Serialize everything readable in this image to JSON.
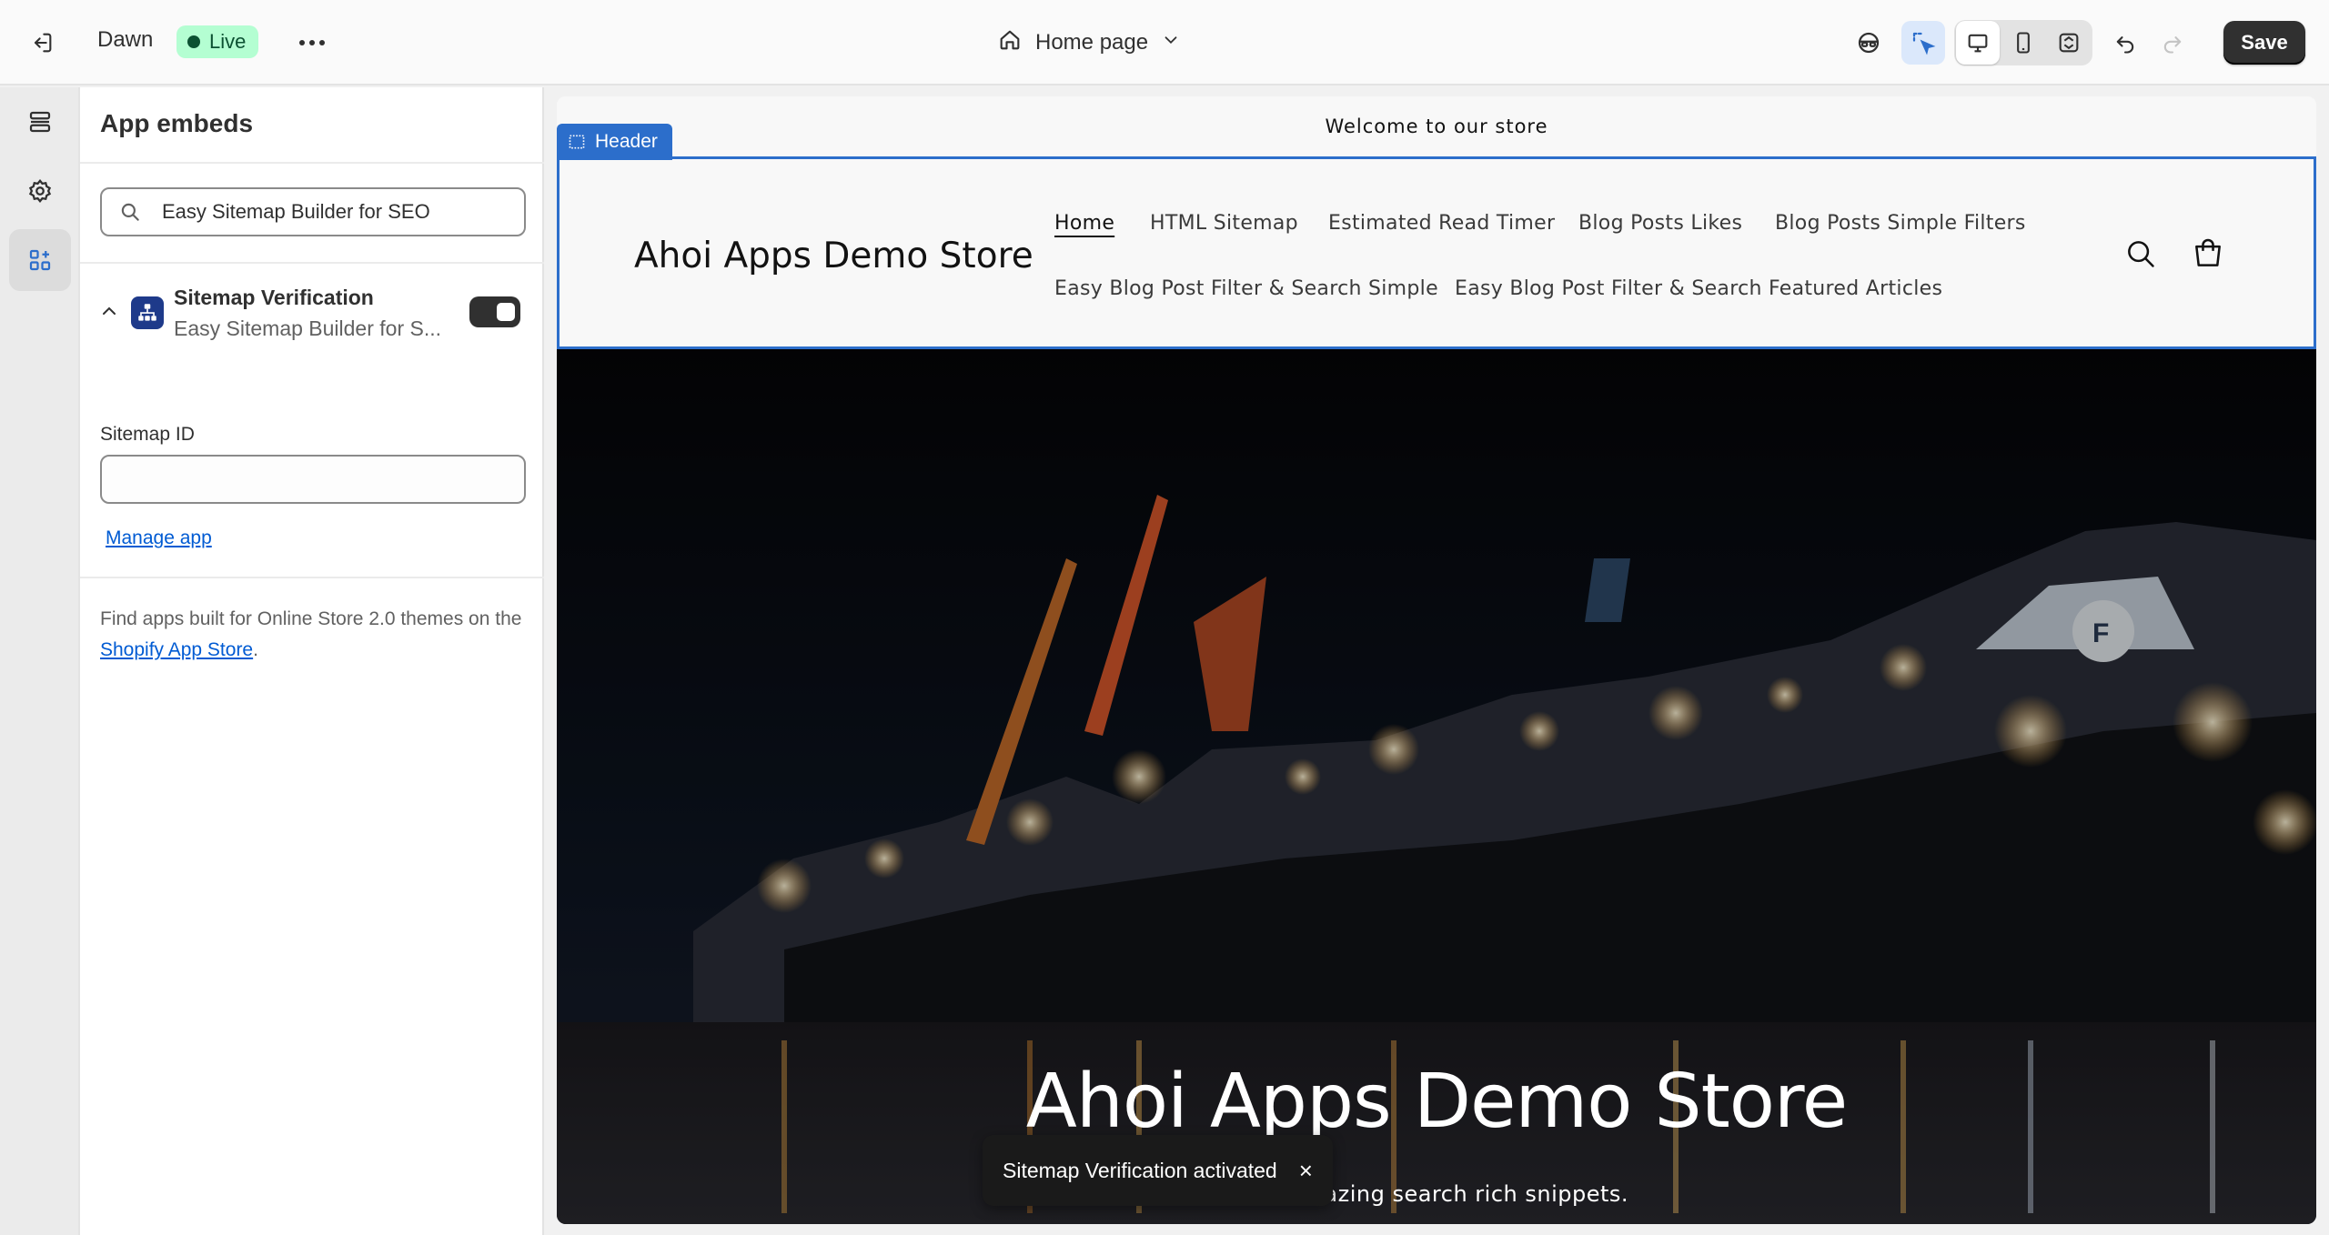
{
  "topbar": {
    "theme_name": "Dawn",
    "live_label": "Live",
    "page_selector": "Home page",
    "save_label": "Save"
  },
  "panel": {
    "title": "App embeds",
    "search_value": "Easy Sitemap Builder for SEO",
    "embed": {
      "name": "Sitemap Verification",
      "subtitle": "Easy Sitemap Builder for S...",
      "enabled": true
    },
    "field_label": "Sitemap ID",
    "field_value": "",
    "manage_link": "Manage app",
    "footer_prefix": "Find apps built for Online Store 2.0 themes on the ",
    "footer_link": "Shopify App Store",
    "footer_suffix": "."
  },
  "preview": {
    "announcement": "Welcome to our store",
    "section_tag": "Header",
    "store_name": "Ahoi Apps Demo Store",
    "nav": [
      "Home",
      "HTML Sitemap",
      "Estimated Read Timer",
      "Blog Posts Likes",
      "Blog Posts Simple Filters",
      "Easy Blog Post Filter & Search Simple",
      "Easy Blog Post Filter & Search Featured Articles"
    ],
    "hero_title": "Ahoi Apps Demo Store",
    "hero_subtitle": "…n amazing search rich snippets."
  },
  "toast": {
    "message": "Sitemap Verification activated",
    "close": "×"
  },
  "colors": {
    "accent": "#2c6ecb",
    "live_bg": "#b4fed2",
    "link": "#005bd3",
    "toast_bg": "#1a1a1a"
  }
}
